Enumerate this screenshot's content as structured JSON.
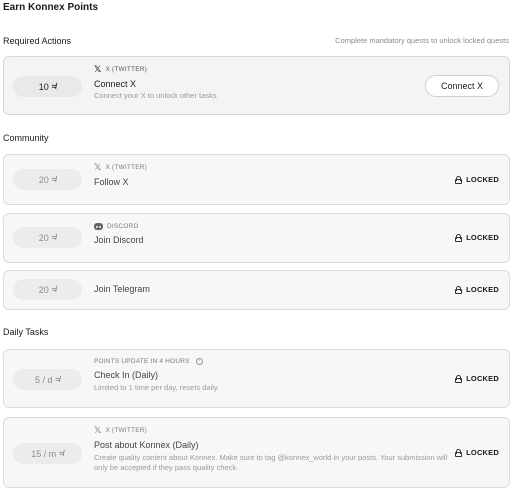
{
  "page_title": "Earn Konnex Points",
  "required": {
    "label": "Required Actions",
    "hint": "Complete mandatory quests to unlock locked quests",
    "card": {
      "points": "10",
      "platform": "X (TWITTER)",
      "title": "Connect X",
      "desc": "Connect your X to unlock other tasks",
      "button": "Connect X"
    }
  },
  "community": {
    "label": "Community",
    "cards": [
      {
        "points": "20",
        "platform": "X (TWITTER)",
        "title": "Follow X",
        "status": "LOCKED"
      },
      {
        "points": "20",
        "platform": "DISCORD",
        "title": "Join Discord",
        "status": "LOCKED"
      },
      {
        "points": "20",
        "title": "Join Telegram",
        "status": "LOCKED"
      }
    ]
  },
  "daily": {
    "label": "Daily Tasks",
    "cards": [
      {
        "points": "5 / d",
        "platform": "POINTS UPDATE IN 4 HOURS",
        "title": "Check In (Daily)",
        "desc": "Limited to 1 time per day, resets daily.",
        "status": "LOCKED"
      },
      {
        "points": "15 / m",
        "platform": "X (TWITTER)",
        "title": "Post about Konnex (Daily)",
        "desc": "Create quality content about Konnex. Make sure to tag @konnex_world in your posts. Your submission will only be accepted if they pass quality check.",
        "status": "LOCKED"
      }
    ]
  },
  "icons": {
    "points": "konnex-k-icon",
    "x": "x-logo-icon",
    "discord": "discord-icon",
    "lock": "lock-icon",
    "info": "info-icon"
  }
}
